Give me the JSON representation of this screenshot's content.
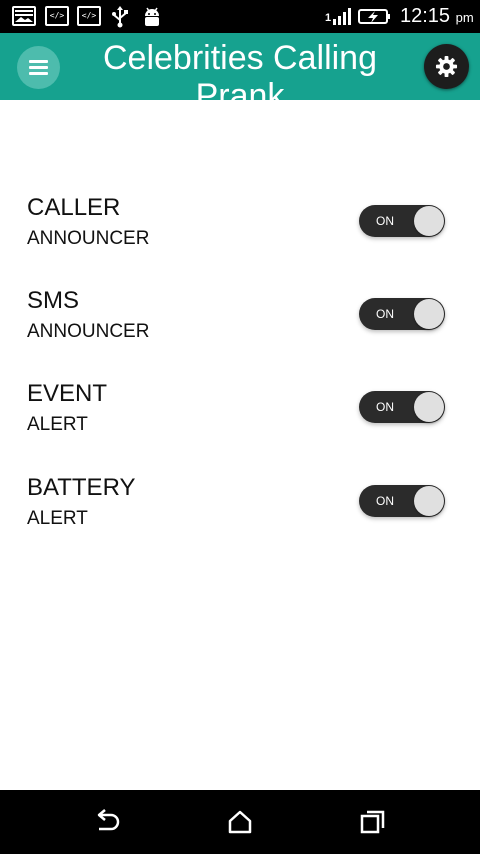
{
  "status_bar": {
    "signal_label": "1",
    "time": "12:15",
    "ampm": "pm",
    "icons": [
      "gallery-icon",
      "code-icon",
      "code-icon",
      "usb-icon",
      "android-icon",
      "signal-icon",
      "battery-charging-icon"
    ]
  },
  "app_bar": {
    "title": "Celebrities Calling Prank",
    "menu_icon": "menu-icon",
    "settings_icon": "gear-icon",
    "color": "#16a28f"
  },
  "settings": [
    {
      "title": "CALLER",
      "subtitle": "ANNOUNCER",
      "toggle_label": "ON",
      "enabled": true
    },
    {
      "title": "SMS",
      "subtitle": "ANNOUNCER",
      "toggle_label": "ON",
      "enabled": true
    },
    {
      "title": "EVENT",
      "subtitle": "ALERT",
      "toggle_label": "ON",
      "enabled": true
    },
    {
      "title": "BATTERY",
      "subtitle": "ALERT",
      "toggle_label": "ON",
      "enabled": true
    }
  ],
  "nav_bar": {
    "buttons": [
      "back-icon",
      "home-icon",
      "recent-apps-icon"
    ]
  }
}
